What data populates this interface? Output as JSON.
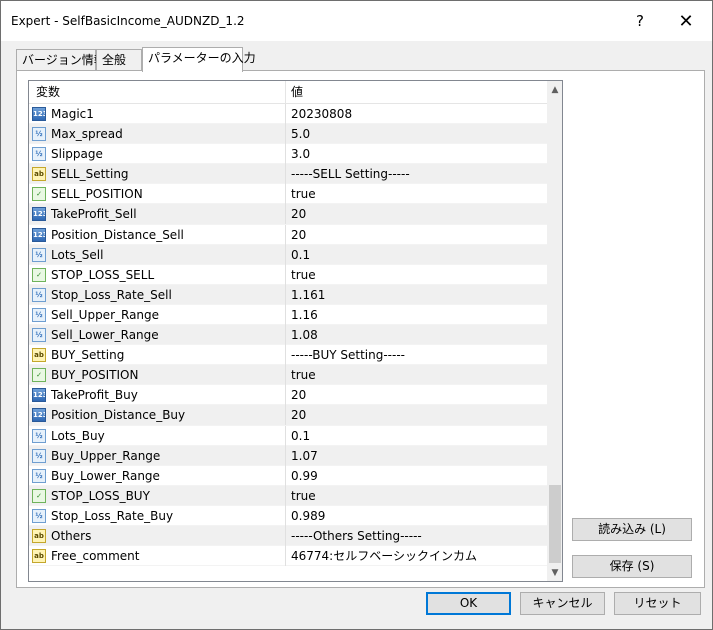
{
  "window": {
    "title": "Expert - SelfBasicIncome_AUDNZD_1.2",
    "help_label": "?",
    "close_label": "✕"
  },
  "tabs": [
    {
      "label": "バージョン情報"
    },
    {
      "label": "全般"
    },
    {
      "label": "パラメーターの入力"
    }
  ],
  "grid": {
    "col_variable": "変数",
    "col_value": "値",
    "rows": [
      {
        "type": "int",
        "name": "Magic1",
        "value": "20230808"
      },
      {
        "type": "double",
        "name": "Max_spread",
        "value": "5.0"
      },
      {
        "type": "double",
        "name": "Slippage",
        "value": "3.0"
      },
      {
        "type": "string",
        "name": "SELL_Setting",
        "value": "-----SELL Setting-----"
      },
      {
        "type": "bool",
        "name": "SELL_POSITION",
        "value": "true"
      },
      {
        "type": "int",
        "name": "TakeProfit_Sell",
        "value": "20"
      },
      {
        "type": "int",
        "name": "Position_Distance_Sell",
        "value": "20"
      },
      {
        "type": "double",
        "name": "Lots_Sell",
        "value": "0.1"
      },
      {
        "type": "bool",
        "name": "STOP_LOSS_SELL",
        "value": "true"
      },
      {
        "type": "double",
        "name": "Stop_Loss_Rate_Sell",
        "value": "1.161"
      },
      {
        "type": "double",
        "name": "Sell_Upper_Range",
        "value": "1.16"
      },
      {
        "type": "double",
        "name": "Sell_Lower_Range",
        "value": "1.08"
      },
      {
        "type": "string",
        "name": "BUY_Setting",
        "value": "-----BUY Setting-----"
      },
      {
        "type": "bool",
        "name": "BUY_POSITION",
        "value": "true"
      },
      {
        "type": "int",
        "name": "TakeProfit_Buy",
        "value": "20"
      },
      {
        "type": "int",
        "name": "Position_Distance_Buy",
        "value": "20"
      },
      {
        "type": "double",
        "name": "Lots_Buy",
        "value": "0.1"
      },
      {
        "type": "double",
        "name": "Buy_Upper_Range",
        "value": "1.07"
      },
      {
        "type": "double",
        "name": "Buy_Lower_Range",
        "value": "0.99"
      },
      {
        "type": "bool",
        "name": "STOP_LOSS_BUY",
        "value": "true"
      },
      {
        "type": "double",
        "name": "Stop_Loss_Rate_Buy",
        "value": "0.989"
      },
      {
        "type": "string",
        "name": "Others",
        "value": "-----Others Setting-----"
      },
      {
        "type": "string",
        "name": "Free_comment",
        "value": "46774:セルフベーシックインカム"
      }
    ]
  },
  "icon_labels": {
    "int": "123",
    "double": "½",
    "string": "ab",
    "bool": "✓"
  },
  "buttons": {
    "load": "読み込み (L)",
    "save": "保存 (S)",
    "ok": "OK",
    "cancel": "キャンセル",
    "reset": "リセット"
  },
  "colors": {
    "focus_border": "#0078d7",
    "row_alt": "#f0f0f0"
  }
}
